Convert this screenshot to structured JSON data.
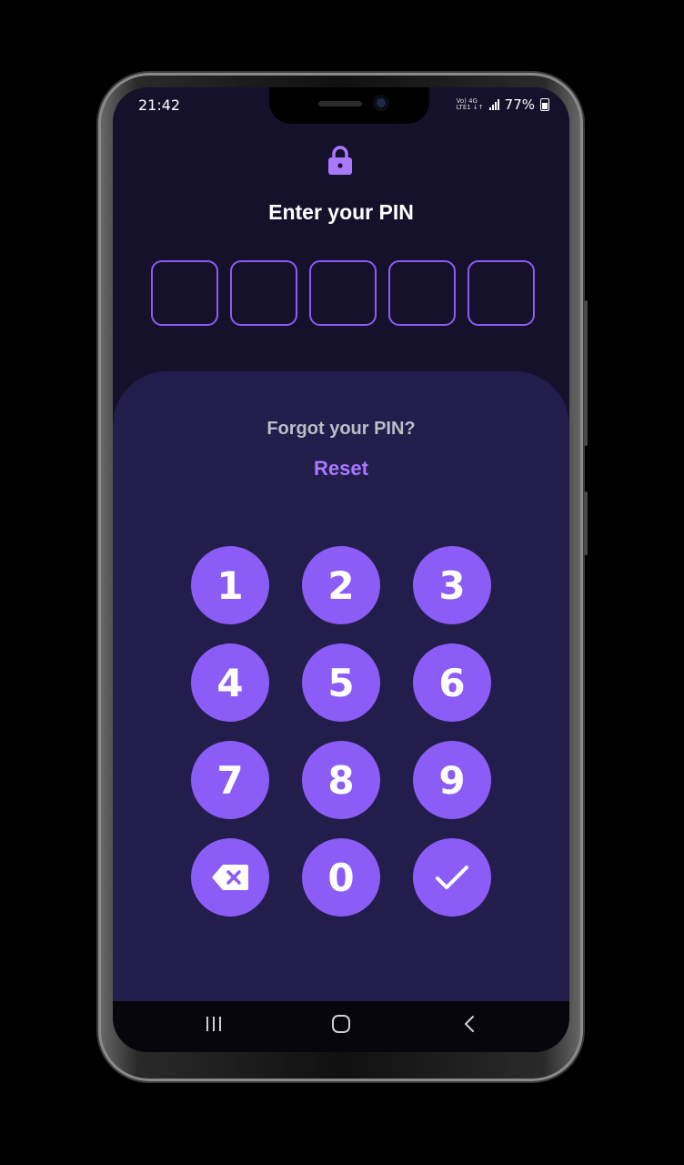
{
  "status_bar": {
    "time": "21:42",
    "network_top": "Vo) 4G",
    "network_bottom": "LTE1 ↓↑",
    "battery": "77%"
  },
  "header": {
    "title": "Enter your PIN",
    "lock_icon": "lock-icon"
  },
  "pin": {
    "length": 5,
    "digits_entered": 0
  },
  "panel": {
    "forgot_text": "Forgot your PIN?",
    "reset_label": "Reset"
  },
  "keypad": {
    "k1": "1",
    "k2": "2",
    "k3": "3",
    "k4": "4",
    "k5": "5",
    "k6": "6",
    "k7": "7",
    "k8": "8",
    "k9": "9",
    "k0": "0",
    "backspace_icon": "backspace-icon",
    "confirm_icon": "check-icon"
  },
  "nav_bar": {
    "recents_icon": "recents-icon",
    "home_icon": "home-icon",
    "back_icon": "back-icon"
  },
  "colors": {
    "background": "#16112b",
    "panel": "#221d4a",
    "accent": "#8b5cf6",
    "reset": "#a879ff",
    "pin_border": "#8a5cf5"
  }
}
